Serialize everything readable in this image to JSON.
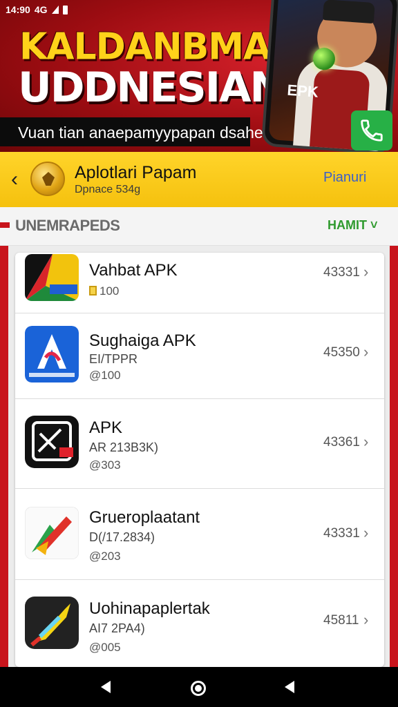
{
  "status_bar": {
    "time": "14:90",
    "network": "4G"
  },
  "banner": {
    "title_line1": "KALDANBMAN",
    "title_line2": "UDDNESIAN",
    "tagline": "Vuan tian anaepamyypapan dsaheen.",
    "phone_label": "EPK"
  },
  "header": {
    "title": "Aplotlari Papam",
    "subtitle": "Dpnace 534g",
    "action": "Pianuri"
  },
  "section": {
    "title": "UNEMRAPEDS",
    "action": "HAMIT"
  },
  "apps": [
    {
      "name": "Vahbat APK",
      "meta": "",
      "meta2": "100",
      "count": "43331"
    },
    {
      "name": "Sughaiga APK",
      "meta": "EI/TPPR",
      "meta2": "@100",
      "count": "45350"
    },
    {
      "name": "APK",
      "meta": "AR 213B3K)",
      "meta2": "@303",
      "count": "43361"
    },
    {
      "name": "Grueroplaatant",
      "meta": "D(/17.2834)",
      "meta2": "@203",
      "count": "43331"
    },
    {
      "name": "Uohinapaplertak",
      "meta": "AI7 2PA4)",
      "meta2": "@005",
      "count": "45811"
    }
  ]
}
